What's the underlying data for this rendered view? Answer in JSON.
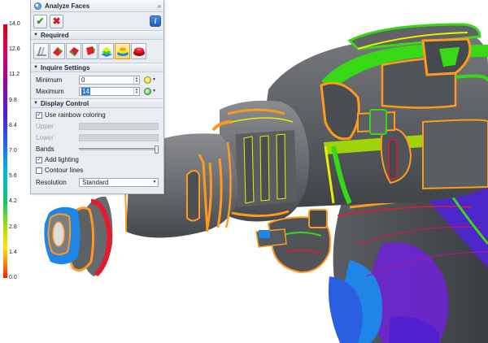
{
  "panel": {
    "title": "Analyze Faces",
    "collapse_glyph": "»",
    "ok_icon": "✔",
    "cancel_icon": "✖",
    "info_icon": "i",
    "required": {
      "label": "Required",
      "tools": [
        {
          "icon": "draft-analysis-icon"
        },
        {
          "icon": "curvature-red-green-icon"
        },
        {
          "icon": "curvature-red-icon"
        },
        {
          "icon": "undercut-icon"
        },
        {
          "icon": "rainbow-layers-icon"
        },
        {
          "icon": "stacked-pads-icon",
          "selected": true
        },
        {
          "icon": "red-shell-icon"
        }
      ]
    },
    "inquire": {
      "label": "Inquire Settings",
      "minimum_label": "Minimum",
      "minimum_value": "0",
      "maximum_label": "Maximum",
      "maximum_value": "14"
    },
    "display": {
      "label": "Display Control",
      "rainbow_label": "Use rainbow coloring",
      "rainbow_checked": true,
      "upper_label": "Upper",
      "lower_label": "Lower",
      "bands_label": "Bands",
      "lighting_label": "Add lighting",
      "lighting_checked": true,
      "contour_label": "Contour lines",
      "contour_checked": false,
      "resolution_label": "Resolution",
      "resolution_value": "Standard"
    }
  },
  "legend": {
    "labels": [
      "14.0",
      "12.6",
      "11.2",
      "9.8",
      "8.4",
      "7.0",
      "5.6",
      "4.2",
      "2.8",
      "1.4",
      "0.0"
    ]
  },
  "colors": {
    "model_body": "#5c5f63",
    "accent_orange": "#ff9a1e",
    "accent_green": "#39d816",
    "accent_yellow": "#e8f000",
    "accent_blue": "#1f86e8",
    "accent_purple": "#6a21d6",
    "accent_red": "#e51b2d"
  }
}
